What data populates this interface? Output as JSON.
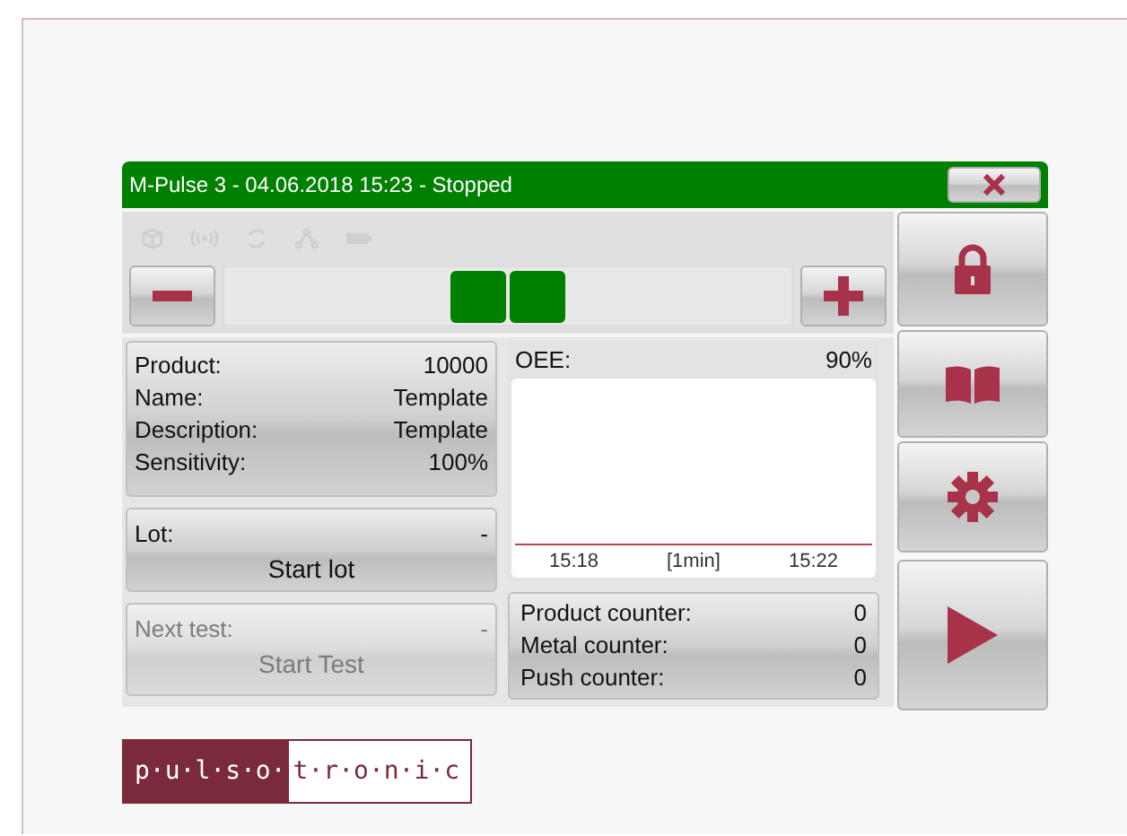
{
  "window": {
    "title": "M-Pulse 3 - 04.06.2018 15:23 - Stopped"
  },
  "product_info": [
    {
      "label": "Product:",
      "value": "10000"
    },
    {
      "label": "Name:",
      "value": "Template"
    },
    {
      "label": "Description:",
      "value": "Template"
    },
    {
      "label": "Sensitivity:",
      "value": "100%"
    }
  ],
  "action_cards": [
    {
      "label": "Lot:",
      "value": "-",
      "action": "Start lot",
      "disabled": false
    },
    {
      "label": "Next test:",
      "value": "-",
      "action": "Start Test",
      "disabled": true
    }
  ],
  "oee": {
    "label": "OEE:",
    "value": "90%",
    "axis_labels": [
      "15:18",
      "[1min]",
      "15:22"
    ]
  },
  "counters": [
    {
      "label": "Product counter:",
      "value": "0"
    },
    {
      "label": "Metal counter:",
      "value": "0"
    },
    {
      "label": "Push counter:",
      "value": "0"
    }
  ],
  "logo": {
    "dark_part": "p·u·l·s·o·",
    "light_part": "t·r·o·n·i·c"
  }
}
